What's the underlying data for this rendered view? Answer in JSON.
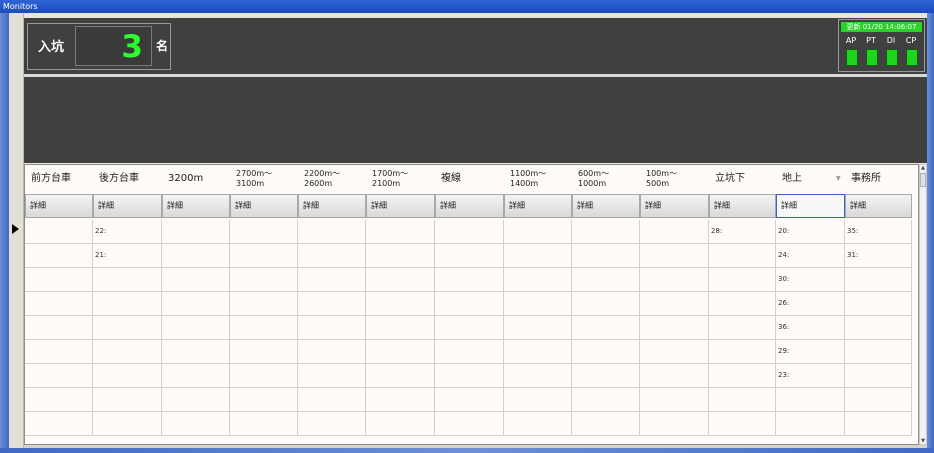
{
  "window": {
    "title": "Monitors"
  },
  "header": {
    "entry_label": "入坑",
    "entry_count": "3",
    "entry_unit": "名",
    "update_time": "更新 01/20 14:06:07",
    "indicators": [
      {
        "label": "AP",
        "color": "#1fd31f"
      },
      {
        "label": "PT",
        "color": "#1fd31f"
      },
      {
        "label": "DI",
        "color": "#1fd31f"
      },
      {
        "label": "CP",
        "color": "#1fd31f"
      }
    ]
  },
  "table": {
    "columns": [
      {
        "label": "前方台車"
      },
      {
        "label": "後方台車"
      },
      {
        "label": "3200m"
      },
      {
        "label": "2700m〜\n3100m"
      },
      {
        "label": "2200m〜\n2600m"
      },
      {
        "label": "1700m〜\n2100m"
      },
      {
        "label": "複線"
      },
      {
        "label": "1100m〜\n1400m"
      },
      {
        "label": "600m〜\n1000m"
      },
      {
        "label": "100m〜\n500m"
      },
      {
        "label": "立坑下"
      },
      {
        "label": "地上"
      },
      {
        "label": "事務所"
      }
    ],
    "detail_label": "詳細",
    "selected_detail_column": 11,
    "rows": [
      [
        "",
        "22:",
        "",
        "",
        "",
        "",
        "",
        "",
        "",
        "",
        "28:",
        "20:",
        "35:"
      ],
      [
        "",
        "21:",
        "",
        "",
        "",
        "",
        "",
        "",
        "",
        "",
        "",
        "24:",
        "31:"
      ],
      [
        "",
        "",
        "",
        "",
        "",
        "",
        "",
        "",
        "",
        "",
        "",
        "30:",
        ""
      ],
      [
        "",
        "",
        "",
        "",
        "",
        "",
        "",
        "",
        "",
        "",
        "",
        "26:",
        ""
      ],
      [
        "",
        "",
        "",
        "",
        "",
        "",
        "",
        "",
        "",
        "",
        "",
        "36:",
        ""
      ],
      [
        "",
        "",
        "",
        "",
        "",
        "",
        "",
        "",
        "",
        "",
        "",
        "29:",
        ""
      ],
      [
        "",
        "",
        "",
        "",
        "",
        "",
        "",
        "",
        "",
        "",
        "",
        "23:",
        ""
      ],
      [
        "",
        "",
        "",
        "",
        "",
        "",
        "",
        "",
        "",
        "",
        "",
        "",
        ""
      ],
      [
        "",
        "",
        "",
        "",
        "",
        "",
        "",
        "",
        "",
        "",
        "",
        "",
        ""
      ]
    ]
  },
  "colors": {
    "panel": "#404040",
    "counter": "#2bff2b",
    "indicator": "#1fd31f",
    "grid_bg": "#fffbf9"
  }
}
